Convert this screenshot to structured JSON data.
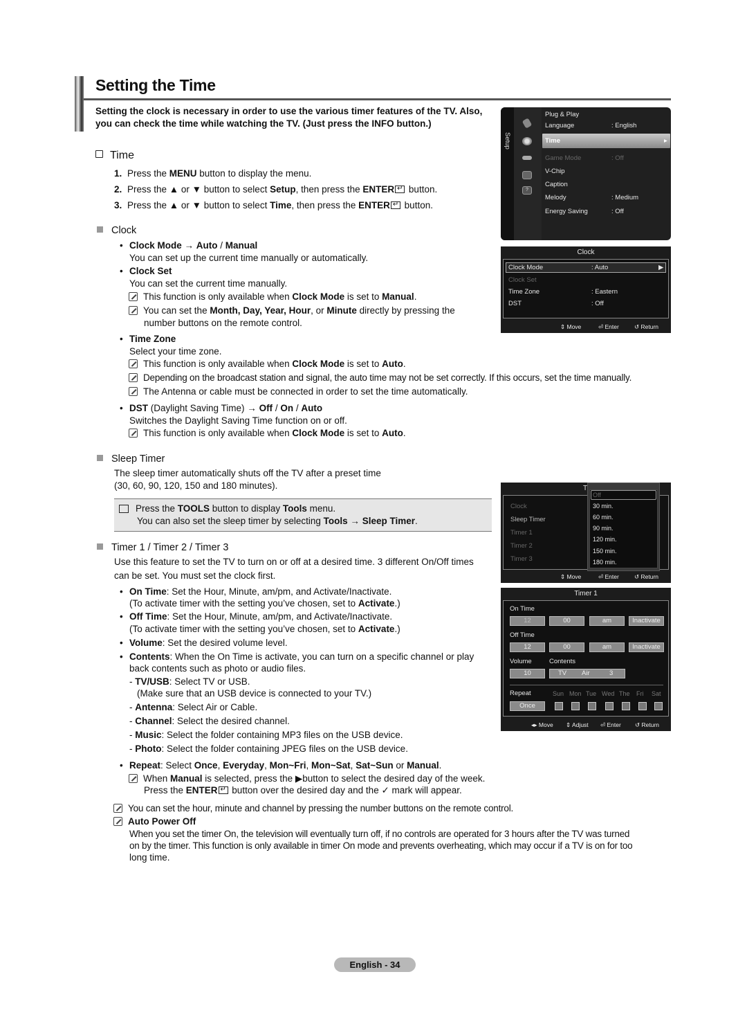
{
  "header": {
    "title": "Setting the Time",
    "intro_line1": "Setting the clock is necessary in order to use the various timer features of the TV. Also,",
    "intro_line2": "you can check the time while watching the TV. (Just press the INFO button.)"
  },
  "time_section": {
    "heading": "Time",
    "steps": [
      {
        "num": "1.",
        "pre": "Press the ",
        "b1": "MENU",
        "mid": " button to display the menu.",
        "b2": "",
        "post": ""
      },
      {
        "num": "2.",
        "pre": "Press the ▲ or ▼ button to select ",
        "b1": "Setup",
        "mid": ", then press the ",
        "b2": "ENTER",
        "post": " button."
      },
      {
        "num": "3.",
        "pre": "Press the ▲ or ▼ button to select ",
        "b1": "Time",
        "mid": ", then press the ",
        "b2": "ENTER",
        "post": " button."
      }
    ]
  },
  "clock": {
    "heading": "Clock",
    "clock_mode": {
      "label": "Clock Mode",
      "arrow": " → ",
      "opt1": "Auto",
      "sep": " / ",
      "opt2": "Manual",
      "desc": "You can set up the current time manually or automatically."
    },
    "clock_set": {
      "label": "Clock Set",
      "desc": "You can set the current time manually.",
      "note1": {
        "pre": "This function is only available when ",
        "b1": "Clock Mode",
        "mid": " is set to ",
        "b2": "Manual",
        "post": "."
      },
      "note2": {
        "pre": "You can set the ",
        "b1": "Month, Day, Year, Hour",
        "mid": ", or ",
        "b2": "Minute",
        "post": " directly by pressing the",
        "line2": "number buttons on the remote control."
      }
    },
    "time_zone": {
      "label": "Time Zone",
      "desc": "Select your time zone.",
      "note1": {
        "pre": "This function is only available when ",
        "b1": "Clock Mode",
        "mid": " is set to ",
        "b2": "Auto",
        "post": "."
      },
      "note2": "Depending on the broadcast station and signal, the auto time may not be set correctly. If this occurs, set the time manually.",
      "note3": "The Antenna or cable must be connected in order to set the time automatically."
    },
    "dst": {
      "label": "DST",
      "paren": " (Daylight Saving Time) → ",
      "opt1": "Off",
      "opt2": "On",
      "opt3": "Auto",
      "sep": " / ",
      "desc": "Switches the Daylight Saving Time function on or off.",
      "note1": {
        "pre": "This function is only available when ",
        "b1": "Clock Mode",
        "mid": " is set to ",
        "b2": "Auto",
        "post": "."
      }
    }
  },
  "sleep_timer": {
    "heading": "Sleep Timer",
    "desc_line1": "The sleep timer automatically shuts off the TV after a preset time",
    "desc_line2": "(30, 60, 90, 120, 150 and 180 minutes).",
    "tools": {
      "l1_pre": "Press the ",
      "l1_b1": "TOOLS",
      "l1_mid": " button to display ",
      "l1_b2": "Tools",
      "l1_post": " menu.",
      "l2_pre": "You can also set the sleep timer by selecting ",
      "l2_b1": "Tools",
      "l2_arrow": " → ",
      "l2_b2": "Sleep Timer",
      "l2_post": "."
    }
  },
  "timers": {
    "heading": "Timer 1 / Timer 2 / Timer 3",
    "desc_line1": "Use this feature to set the TV to turn on or off at a desired time. 3 different On/Off times",
    "desc_line2": "can be set. You must set the clock first.",
    "on_time": {
      "label": "On Time",
      "desc": ": Set the Hour, Minute, am/pm, and Activate/Inactivate.",
      "l2_pre": "(To activate timer with the setting you’ve chosen, set to ",
      "l2_b": "Activate",
      "l2_post": ".)"
    },
    "off_time": {
      "label": "Off Time",
      "desc": ": Set the Hour, Minute, am/pm, and Activate/Inactivate.",
      "l2_pre": "(To activate timer with the setting you’ve chosen, set to ",
      "l2_b": "Activate",
      "l2_post": ".)"
    },
    "volume": {
      "label": "Volume",
      "desc": ": Set the desired volume level."
    },
    "contents": {
      "label": "Contents",
      "desc": ": When the On Time is activate, you can turn on a specific channel or play",
      "desc2": "back contents such as photo or audio files.",
      "items": [
        {
          "label": "TV/USB",
          "desc": ": Select TV or USB."
        },
        {
          "label": "",
          "desc": "(Make sure that an USB device is connected to your TV.)"
        },
        {
          "label": "Antenna",
          "desc": ": Select Air or Cable."
        },
        {
          "label": "Channel",
          "desc": ": Select the desired channel."
        },
        {
          "label": "Music",
          "desc": ": Select the folder containing MP3 files on the USB device."
        },
        {
          "label": "Photo",
          "desc": ": Select the folder containing JPEG files on the USB device."
        }
      ]
    },
    "repeat": {
      "label": "Repeat",
      "pre": ": Select ",
      "o1": "Once",
      "o2": "Everyday",
      "o3": "Mon~Fri",
      "o4": "Mon~Sat",
      "o5": "Sat~Sun",
      "o6": "Manual",
      "c": ", ",
      "or": " or ",
      "end": ".",
      "note_pre": "When ",
      "note_b": "Manual",
      "note_post": " is selected, press the ▶button to select the desired day of the week.",
      "note2_pre": "Press the ",
      "note2_b": "ENTER",
      "note2_post": " button over the desired day and the ✓ mark will appear."
    },
    "note_numbers": "You can set the hour, minute and channel by pressing the number buttons on the remote control.",
    "auto_power_off": {
      "label": "Auto Power Off",
      "line1": "When you set the timer On, the television will eventually turn off, if no controls are operated for 3 hours after the TV was turned",
      "line2": "on by the timer. This function is only available in timer On mode and prevents overheating, which may occur if a TV is on for too",
      "line3": "long time."
    }
  },
  "osd_setup": {
    "tab_label": "Setup",
    "items": [
      {
        "label": "Plug & Play",
        "value": ""
      },
      {
        "label": "Language",
        "value": ": English"
      },
      {
        "label": "Time",
        "value": ""
      },
      {
        "label": "Game Mode",
        "value": ": Off"
      },
      {
        "label": "V-Chip",
        "value": ""
      },
      {
        "label": "Caption",
        "value": ""
      },
      {
        "label": "Melody",
        "value": ": Medium"
      },
      {
        "label": "Energy Saving",
        "value": ": Off"
      }
    ],
    "selected_arrow": "▸"
  },
  "osd_clock": {
    "title": "Clock",
    "rows": [
      {
        "label": "Clock Mode",
        "value": ": Auto",
        "arrow": "▶"
      },
      {
        "label": "Clock Set",
        "value": ""
      },
      {
        "label": "Time Zone",
        "value": ": Eastern"
      },
      {
        "label": "DST",
        "value": ": Off"
      }
    ],
    "footer": {
      "move": "Move",
      "enter": "Enter",
      "return": "Return"
    }
  },
  "osd_sleep": {
    "title_partial": "Ti",
    "rows": [
      "Clock",
      "Sleep Timer",
      "Timer 1",
      "Timer 2",
      "Timer 3"
    ],
    "options": [
      "Off",
      "30 min.",
      "60 min.",
      "90 min.",
      "120 min.",
      "150 min.",
      "180 min."
    ],
    "footer": {
      "move": "Move",
      "enter": "Enter",
      "return": "Return"
    }
  },
  "osd_timer": {
    "title": "Timer 1",
    "on_time_label": "On Time",
    "on_time": [
      "12",
      "00",
      "am",
      "Inactivate"
    ],
    "off_time_label": "Off Time",
    "off_time": [
      "12",
      "00",
      "am",
      "Inactivate"
    ],
    "volume_label": "Volume",
    "volume": "10",
    "contents_label": "Contents",
    "contents": {
      "source": "TV",
      "antenna": "Air",
      "channel": "3"
    },
    "repeat_label": "Repeat",
    "repeat_value": "Once",
    "days": [
      "Sun",
      "Mon",
      "Tue",
      "Wed",
      "The",
      "Fri",
      "Sat"
    ],
    "footer": {
      "move": "Move",
      "adjust": "Adjust",
      "enter": "Enter",
      "return": "Return"
    }
  },
  "footer": {
    "page_label": "English - 34"
  }
}
